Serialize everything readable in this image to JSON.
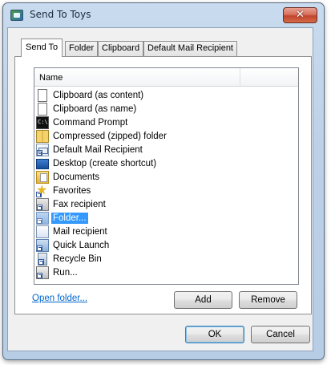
{
  "window": {
    "title": "Send To Toys",
    "close_glyph": "✕"
  },
  "tabs": [
    {
      "label": "Send To",
      "active": true
    },
    {
      "label": "Folder",
      "active": false
    },
    {
      "label": "Clipboard",
      "active": false
    },
    {
      "label": "Default Mail Recipient",
      "active": false
    }
  ],
  "list": {
    "column_header": "Name",
    "items": [
      {
        "label": "Clipboard (as content)",
        "icon": "document-icon",
        "selected": false
      },
      {
        "label": "Clipboard (as name)",
        "icon": "document-icon",
        "selected": false
      },
      {
        "label": "Command Prompt",
        "icon": "command-prompt-icon",
        "selected": false
      },
      {
        "label": "Compressed (zipped) folder",
        "icon": "zip-folder-icon",
        "selected": false
      },
      {
        "label": "Default Mail Recipient",
        "icon": "mail-shortcut-icon",
        "selected": false
      },
      {
        "label": "Desktop (create shortcut)",
        "icon": "desktop-icon",
        "selected": false
      },
      {
        "label": "Documents",
        "icon": "documents-folder-icon",
        "selected": false
      },
      {
        "label": "Favorites",
        "icon": "favorites-star-icon",
        "selected": false
      },
      {
        "label": "Fax recipient",
        "icon": "fax-icon",
        "selected": false
      },
      {
        "label": "Folder...",
        "icon": "folder-shortcut-icon",
        "selected": true
      },
      {
        "label": "Mail recipient",
        "icon": "mail-icon",
        "selected": false
      },
      {
        "label": "Quick Launch",
        "icon": "quick-launch-icon",
        "selected": false
      },
      {
        "label": "Recycle Bin",
        "icon": "recycle-bin-icon",
        "selected": false
      },
      {
        "label": "Run...",
        "icon": "run-icon",
        "selected": false
      }
    ]
  },
  "actions": {
    "open_folder_link": "Open folder...",
    "add_label": "Add",
    "remove_label": "Remove"
  },
  "dialog_buttons": {
    "ok_label": "OK",
    "cancel_label": "Cancel"
  },
  "colors": {
    "selection": "#3399ff",
    "link": "#0066cc",
    "close_button": "#c2452e"
  }
}
